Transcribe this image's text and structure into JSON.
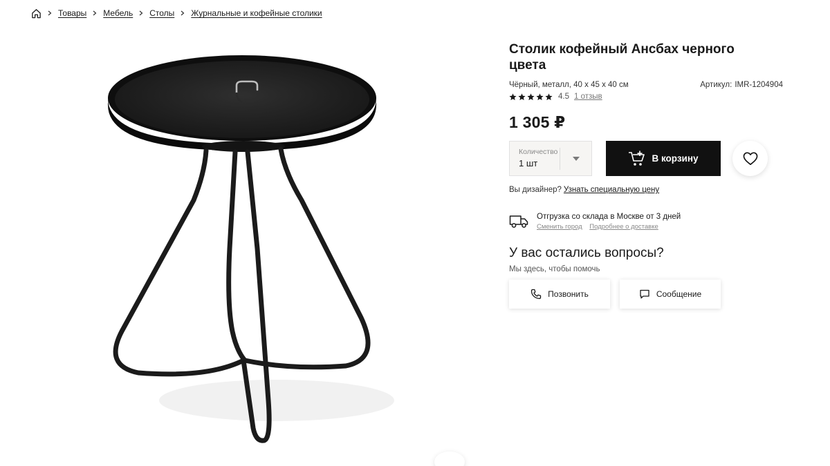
{
  "breadcrumb": {
    "items": [
      "Товары",
      "Мебель",
      "Столы",
      "Журнальные и кофейные столики"
    ]
  },
  "product": {
    "title": "Столик кофейный Ансбах черного цвета",
    "specs": "Чёрный, металл, 40 х 45 х 40 см",
    "sku_label": "Артикул:",
    "sku_value": "IMR-1204904",
    "rating": "4.5",
    "reviews": "1 отзыв",
    "price": "1 305 ₽"
  },
  "purchase": {
    "qty_label": "Количество",
    "qty_value": "1 шт",
    "cart_label": "В корзину"
  },
  "designer": {
    "text": "Вы дизайнер?",
    "link": "Узнать специальную цену"
  },
  "delivery": {
    "text": "Отгрузка со склада в Москве от 3 дней",
    "change_city": "Сменить город",
    "more": "Подробнее о доставке"
  },
  "support": {
    "title": "У вас остались вопросы?",
    "subtitle": "Мы здесь, чтобы помочь",
    "call_label": "Позвонить",
    "message_label": "Сообщение"
  },
  "icons": {
    "home": "home-icon",
    "chevron": "chevron-right-icon",
    "star": "star-icon",
    "dropdown": "caret-down-icon",
    "cart": "cart-add-icon",
    "favorite": "heart-icon",
    "truck": "truck-icon",
    "phone": "phone-icon",
    "message": "chat-icon"
  },
  "colors": {
    "accent": "#111111",
    "text": "#1a1a1a",
    "muted": "#888888",
    "qty_bg": "#f6f5f3"
  }
}
